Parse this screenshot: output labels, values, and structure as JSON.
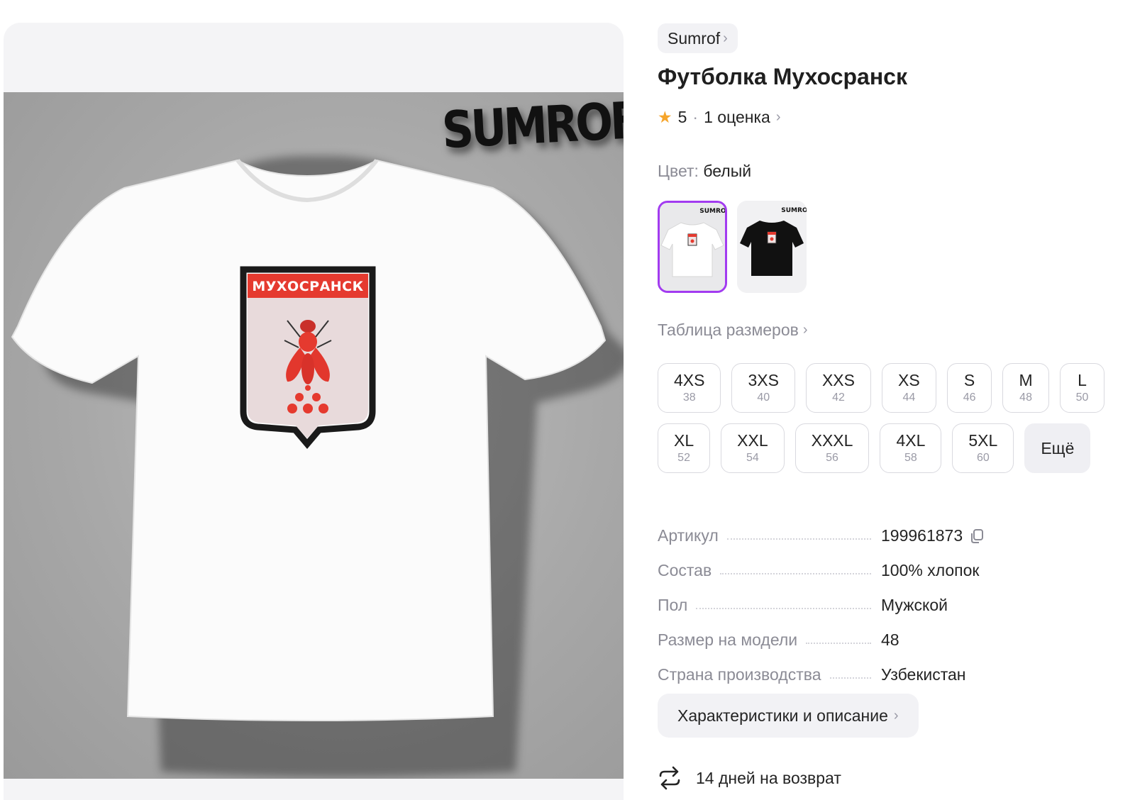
{
  "gallery": {
    "watermark": "SUMROF",
    "crest_title": "МУХОСРАНСК"
  },
  "brand": {
    "label": "Sumrof",
    "chevron": "›"
  },
  "product": {
    "title": "Футболка Мухосранск"
  },
  "rating": {
    "value": "5",
    "separator": "·",
    "count_label": "1 оценка",
    "chevron": "›"
  },
  "color": {
    "label": "Цвет:",
    "value": "белый"
  },
  "swatches": [
    {
      "name": "white-tshirt",
      "selected": true
    },
    {
      "name": "black-tshirt",
      "selected": false
    }
  ],
  "size_table": {
    "label": "Таблица размеров",
    "chevron": "›"
  },
  "sizes": [
    {
      "size": "4XS",
      "ru": "38"
    },
    {
      "size": "3XS",
      "ru": "40"
    },
    {
      "size": "XXS",
      "ru": "42"
    },
    {
      "size": "XS",
      "ru": "44"
    },
    {
      "size": "S",
      "ru": "46"
    },
    {
      "size": "M",
      "ru": "48"
    },
    {
      "size": "L",
      "ru": "50"
    },
    {
      "size": "XL",
      "ru": "52"
    },
    {
      "size": "XXL",
      "ru": "54"
    },
    {
      "size": "XXXL",
      "ru": "56"
    },
    {
      "size": "4XL",
      "ru": "58"
    },
    {
      "size": "5XL",
      "ru": "60"
    }
  ],
  "more_sizes": {
    "label": "Ещё"
  },
  "specs": [
    {
      "key": "Артикул",
      "value": "199961873"
    },
    {
      "key": "Состав",
      "value": "100% хлопок"
    },
    {
      "key": "Пол",
      "value": "Мужской"
    },
    {
      "key": "Размер на модели",
      "value": "48"
    },
    {
      "key": "Страна производства",
      "value": "Узбекистан"
    }
  ],
  "description_button": {
    "label": "Характеристики и описание",
    "chevron": "›"
  },
  "returns": {
    "label": "14 дней на возврат"
  },
  "icons": {
    "star": "star-icon",
    "copy": "copy-icon",
    "return": "return-arrows-icon"
  },
  "colors": {
    "accent": "#a23bf0",
    "star": "#f6a52b",
    "crest_red": "#e53a2f"
  }
}
